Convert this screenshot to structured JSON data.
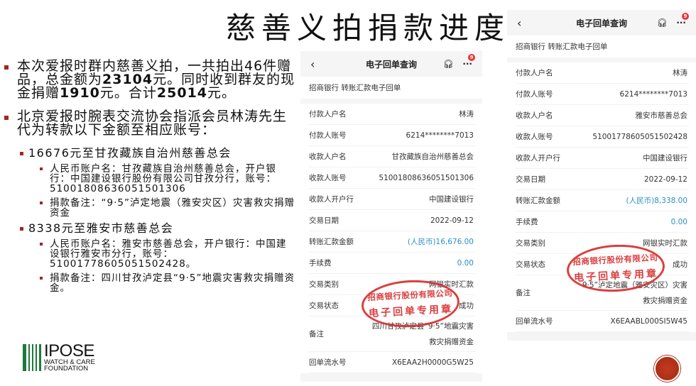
{
  "title": "慈善义拍捐款进度",
  "left": {
    "p1": {
      "a": "本次爱报时群内慈善义拍，一共拍出46件赠品，总金额为",
      "b": "23104",
      "c": "元。同时收到群友的现金捐赠",
      "d": "1910",
      "e": "元。合计",
      "f": "25014",
      "g": "元。"
    },
    "p2": "北京爱报时腕表交流协会指派会员林涛先生代为转款以下金额至相应账号：",
    "s1": "16676元至甘孜藏族自治州慈善总会",
    "s1a": "人民币账户名：甘孜藏族自治州慈善总会，开户银行：中国建设银行股份有限公司甘孜分行，账号：51001808636051501306",
    "s1b": "捐款备注：“9·5”泸定地震（雅安灾区）灾害救灾捐赠资金",
    "s2": "8338元至雅安市慈善总会",
    "s2a": "人民币账户名：雅安市慈善总会，开户银行：中国建设银行雅安市分行，账号：51001778605051502428。",
    "s2b": "捐款备注：四川甘孜泸定县“9·5”地震灾害救灾捐赠资金。"
  },
  "logo": {
    "name": "IPOSE",
    "line1": "WATCH & CARE",
    "line2": "FOUNDATION"
  },
  "receipts": [
    {
      "header": "电子回单查询",
      "badge": "9",
      "subtitle": "招商银行  转账汇款电子回单",
      "rows": [
        [
          "付款人户名",
          "林涛"
        ],
        [
          "付款人账号",
          "6214********7013"
        ],
        [
          "收款人户名",
          "甘孜藏族自治州慈善总会"
        ],
        [
          "收款人账号",
          "51001808636051501306"
        ],
        [
          "收款人开户行",
          "中国建设银行"
        ],
        [
          "交易日期",
          "2022-09-12"
        ],
        [
          "转账汇款金额",
          "(人民币)16,676.00"
        ],
        [
          "手续费",
          "0.00"
        ],
        [
          "交易类别",
          "网银实时汇款"
        ],
        [
          "交易状态",
          "成功"
        ],
        [
          "备注",
          "四川甘孜泸定县“9·5”地震灾害\n救灾捐赠资金"
        ],
        [
          "回单流水号",
          "X6EAA2H0000G5W25"
        ]
      ],
      "stamp": [
        "招商银行股份有限公司",
        "电子回单专用章"
      ]
    },
    {
      "header": "电子回单查询",
      "badge": "9",
      "subtitle": "招商银行  转账汇款电子回单",
      "rows": [
        [
          "付款人户名",
          "林涛"
        ],
        [
          "付款人账号",
          "6214********7013"
        ],
        [
          "收款人户名",
          "雅安市慈善总会"
        ],
        [
          "收款人账号",
          "51001778605051502428"
        ],
        [
          "收款人开户行",
          "中国建设银行"
        ],
        [
          "交易日期",
          "2022-09-12"
        ],
        [
          "转账汇款金额",
          "(人民币)8,338.00"
        ],
        [
          "手续费",
          "0.00"
        ],
        [
          "交易类别",
          "网银实时汇款"
        ],
        [
          "交易状态",
          "成功"
        ],
        [
          "备注",
          "9·5”泸定地震（雅安灾区）灾害\n救灾捐赠资金"
        ],
        [
          "回单流水号",
          "X6EAABL000SI5W45"
        ]
      ],
      "stamp": [
        "招商银行股份有限公司",
        "电子回单专用章"
      ]
    }
  ],
  "colors": {
    "bullet": "#a0281c",
    "amount": "#2a8fc6",
    "stamp": "#d92a2a",
    "logo": "#1e7a3c"
  }
}
